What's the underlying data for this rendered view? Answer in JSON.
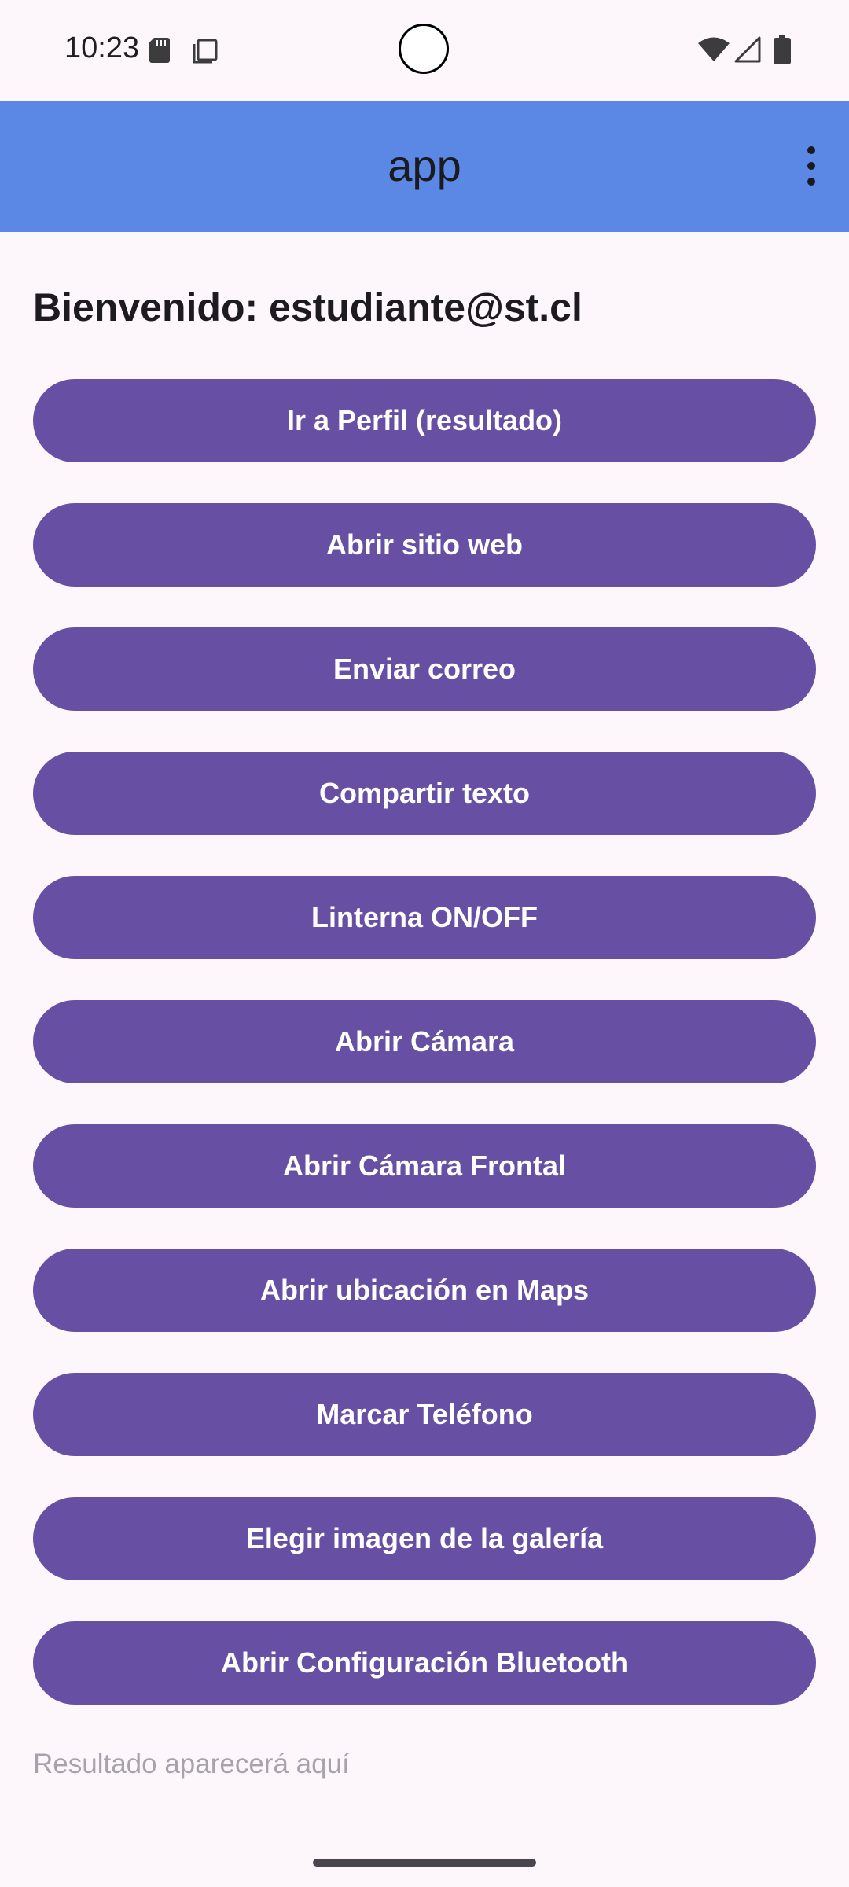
{
  "status_bar": {
    "time": "10:23",
    "icons": [
      "sd-card-icon",
      "recent-apps-icon",
      "camera-cutout",
      "wifi-icon",
      "cell-signal-icon",
      "battery-icon"
    ]
  },
  "app_bar": {
    "title": "app",
    "menu_icon": "more-vert-icon",
    "background_color": "#5b87e5"
  },
  "main": {
    "welcome": "Bienvenido: estudiante@st.cl",
    "buttons": [
      {
        "label": "Ir a Perfil (resultado)"
      },
      {
        "label": "Abrir sitio web"
      },
      {
        "label": "Enviar correo"
      },
      {
        "label": "Compartir texto"
      },
      {
        "label": "Linterna ON/OFF"
      },
      {
        "label": "Abrir Cámara"
      },
      {
        "label": "Abrir Cámara Frontal"
      },
      {
        "label": "Abrir ubicación en Maps"
      },
      {
        "label": "Marcar Teléfono"
      },
      {
        "label": "Elegir imagen de la galería"
      },
      {
        "label": "Abrir Configuración Bluetooth"
      }
    ],
    "button_color": "#6750a4",
    "result_text": "Resultado aparecerá aquí"
  }
}
